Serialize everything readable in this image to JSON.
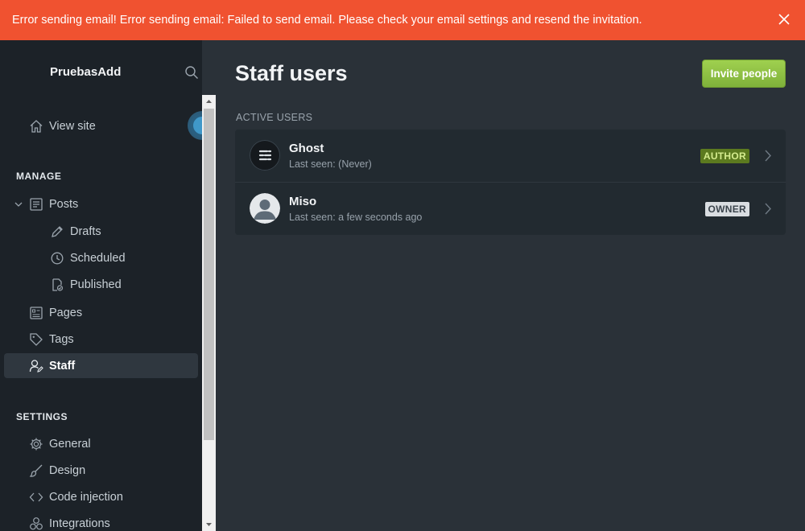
{
  "banner": {
    "message": "Error sending email! Error sending email: Failed to send email. Please check your email settings and resend the invitation."
  },
  "sidebar": {
    "brand": "PruebasAdd",
    "view_site": "View site",
    "manage_heading": "MANAGE",
    "posts": "Posts",
    "drafts": "Drafts",
    "scheduled": "Scheduled",
    "published": "Published",
    "pages": "Pages",
    "tags": "Tags",
    "staff": "Staff",
    "settings_heading": "SETTINGS",
    "general": "General",
    "design": "Design",
    "code_injection": "Code injection",
    "integrations": "Integrations"
  },
  "main": {
    "title": "Staff users",
    "invite_label": "Invite people",
    "section_label": "ACTIVE USERS",
    "users": [
      {
        "name": "Ghost",
        "last_seen": "Last seen: (Never)",
        "role": "AUTHOR",
        "avatar": "ghost-logo-icon"
      },
      {
        "name": "Miso",
        "last_seen": "Last seen: a few seconds ago",
        "role": "OWNER",
        "avatar": "default-user-icon"
      }
    ]
  },
  "colors": {
    "banner": "#f05230",
    "sidebar": "#1c2228",
    "main": "#2a3138",
    "accent": "#9fd04f",
    "author_badge": "#5c7a1f",
    "owner_badge": "#d9dde1"
  }
}
